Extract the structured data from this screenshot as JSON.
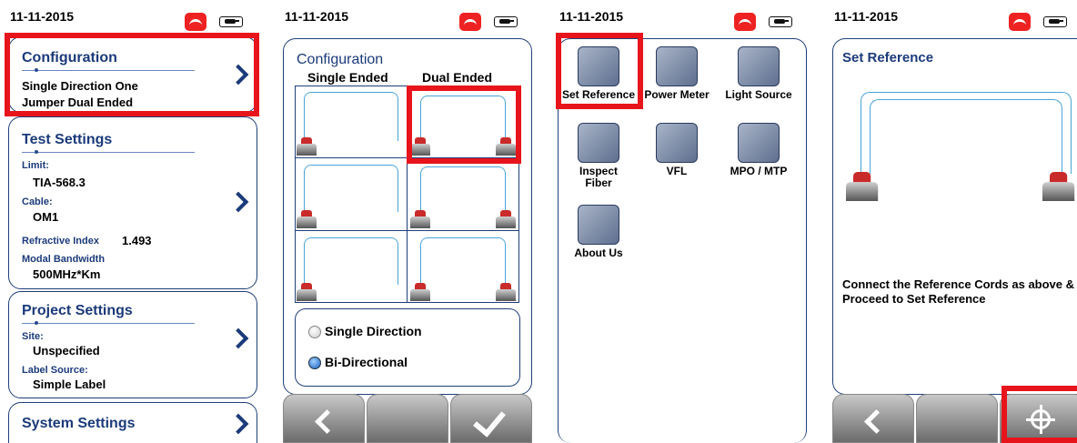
{
  "status": {
    "date": "11-11-2015"
  },
  "screen1": {
    "config": {
      "title": "Configuration",
      "line1": "Single Direction One",
      "line2": "Jumper Dual Ended"
    },
    "test": {
      "title": "Test Settings",
      "limit_label": "Limit:",
      "limit_value": "TIA-568.3",
      "cable_label": "Cable:",
      "cable_value": "OM1",
      "ri_label": "Refractive Index",
      "ri_value": "1.493",
      "mb_label": "Modal Bandwidth",
      "mb_value": "500MHz*Km"
    },
    "project": {
      "title": "Project Settings",
      "site_label": "Site:",
      "site_value": "Unspecified",
      "ls_label": "Label Source:",
      "ls_value": "Simple Label"
    },
    "system": {
      "title": "System Settings"
    }
  },
  "screen2": {
    "title": "Configuration",
    "col_single": "Single Ended",
    "col_dual": "Dual Ended",
    "radio_single": "Single Direction",
    "radio_bidir": "Bi-Directional",
    "selected": "Bi-Directional"
  },
  "screen3": {
    "apps": [
      {
        "label": "Set Reference",
        "icon": "set-reference-icon"
      },
      {
        "label": "Power Meter",
        "icon": "power-meter-icon"
      },
      {
        "label": "Light Source",
        "icon": "light-source-icon"
      },
      {
        "label": "Inspect Fiber",
        "icon": "inspect-fiber-icon"
      },
      {
        "label": "VFL",
        "icon": "vfl-icon"
      },
      {
        "label": "MPO / MTP",
        "icon": "mpo-mtp-icon"
      },
      {
        "label": "About Us",
        "icon": "info-icon"
      }
    ]
  },
  "screen4": {
    "title": "Set Reference",
    "message": "Connect the Reference Cords as above & Proceed to Set Reference"
  },
  "colors": {
    "highlight": "#e8141b",
    "accent": "#1b3a7a",
    "fiber": "#4aa4d8"
  }
}
